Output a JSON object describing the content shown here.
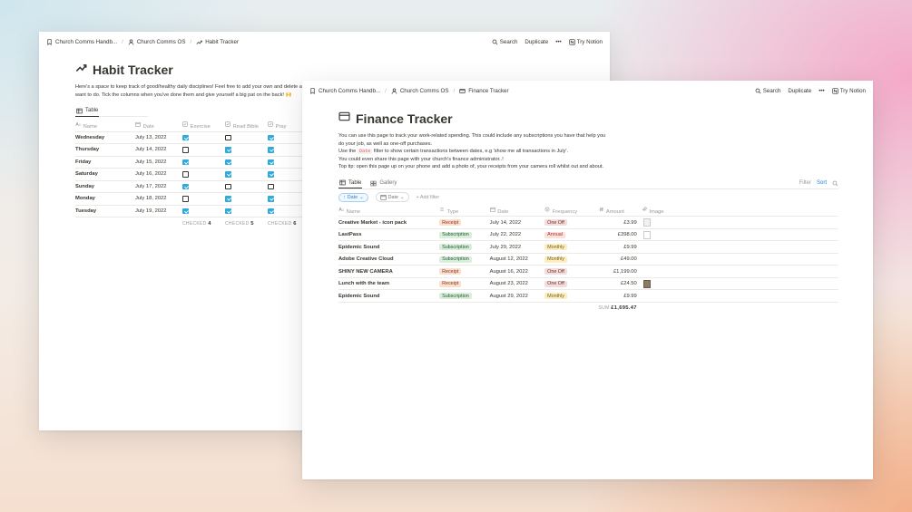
{
  "habit": {
    "breadcrumb": [
      "Church Comms Handb...",
      "Church Comms OS",
      "Habit Tracker"
    ],
    "actions": {
      "search": "Search",
      "duplicate": "Duplicate",
      "more": "•••",
      "try": "Try Notion"
    },
    "title": "Habit Tracker",
    "description": [
      "Here's a space to keep track of good/healthy daily disciplines! Feel free to add your own and delete any that you don't",
      "want to do. Tick the columns when you've done them and give yourself a big pat on the back! 🙌"
    ],
    "tab": "Table",
    "columns": [
      "Name",
      "Date",
      "Exercise",
      "Read Bible",
      "Pray"
    ],
    "rows": [
      {
        "name": "Wednesday",
        "date": "July 13, 2022",
        "exercise": true,
        "bible": false,
        "pray": true
      },
      {
        "name": "Thursday",
        "date": "July 14, 2022",
        "exercise": false,
        "bible": true,
        "pray": true
      },
      {
        "name": "Friday",
        "date": "July 15, 2022",
        "exercise": true,
        "bible": true,
        "pray": true
      },
      {
        "name": "Saturday",
        "date": "July 16, 2022",
        "exercise": false,
        "bible": true,
        "pray": true
      },
      {
        "name": "Sunday",
        "date": "July 17, 2022",
        "exercise": true,
        "bible": false,
        "pray": false
      },
      {
        "name": "Monday",
        "date": "July 18, 2022",
        "exercise": false,
        "bible": true,
        "pray": true
      },
      {
        "name": "Tuesday",
        "date": "July 19, 2022",
        "exercise": true,
        "bible": true,
        "pray": true
      }
    ],
    "footer": {
      "label": "CHECKED",
      "exercise": "4",
      "bible": "5",
      "pray": "6"
    }
  },
  "finance": {
    "breadcrumb": [
      "Church Comms Handb...",
      "Church Comms OS",
      "Finance Tracker"
    ],
    "actions": {
      "search": "Search",
      "duplicate": "Duplicate",
      "more": "•••",
      "try": "Try Notion"
    },
    "title": "Finance Tracker",
    "description": {
      "line1": "You can use this page to track your work-related spending. This could include any subscriptions you have that help you",
      "line2": "do your job, as well as one-off purchases.",
      "line3_pre": "Use the ",
      "line3_code": "Date",
      "line3_post": " filter to show certain transactions between dates, e.g 'show me all transactions in July'.",
      "line4": "You could even share this page with your church's finance administrator..!",
      "line5": "Top tip: open this page up on your phone and add a photo of, your receipts from your camera roll whilst out and about."
    },
    "tabs": [
      "Table",
      "Gallery"
    ],
    "tools": {
      "filter": "Filter",
      "sort": "Sort"
    },
    "filters": {
      "date_chip": "Date",
      "date_chip2": "Date",
      "add": "Add filter"
    },
    "columns": [
      "Name",
      "Type",
      "Date",
      "Frequency",
      "Amount",
      "Image"
    ],
    "rows": [
      {
        "name": "Creative Market - icon pack",
        "type": "Receipt",
        "date": "July 14, 2022",
        "freq": "One Off",
        "amount": "£3.99",
        "img": "light"
      },
      {
        "name": "LastPass",
        "type": "Subscription",
        "date": "July 22, 2022",
        "freq": "Annual",
        "amount": "£398.00",
        "img": "blank"
      },
      {
        "name": "Epidemic Sound",
        "type": "Subscription",
        "date": "July 29, 2022",
        "freq": "Monthly",
        "amount": "£9.99",
        "img": ""
      },
      {
        "name": "Adobe Creative Cloud",
        "type": "Subscription",
        "date": "August 12, 2022",
        "freq": "Monthly",
        "amount": "£49.00",
        "img": ""
      },
      {
        "name": "SHINY NEW CAMERA",
        "type": "Receipt",
        "date": "August 16, 2022",
        "freq": "One Off",
        "amount": "£1,199.00",
        "img": ""
      },
      {
        "name": "Lunch with the team",
        "type": "Receipt",
        "date": "August 23, 2022",
        "freq": "One Off",
        "amount": "£24.50",
        "img": "dark"
      },
      {
        "name": "Epidemic Sound",
        "type": "Subscription",
        "date": "August 29, 2022",
        "freq": "Monthly",
        "amount": "£9.99",
        "img": ""
      }
    ],
    "sum": {
      "label": "SUM",
      "value": "£1,695.47"
    }
  }
}
